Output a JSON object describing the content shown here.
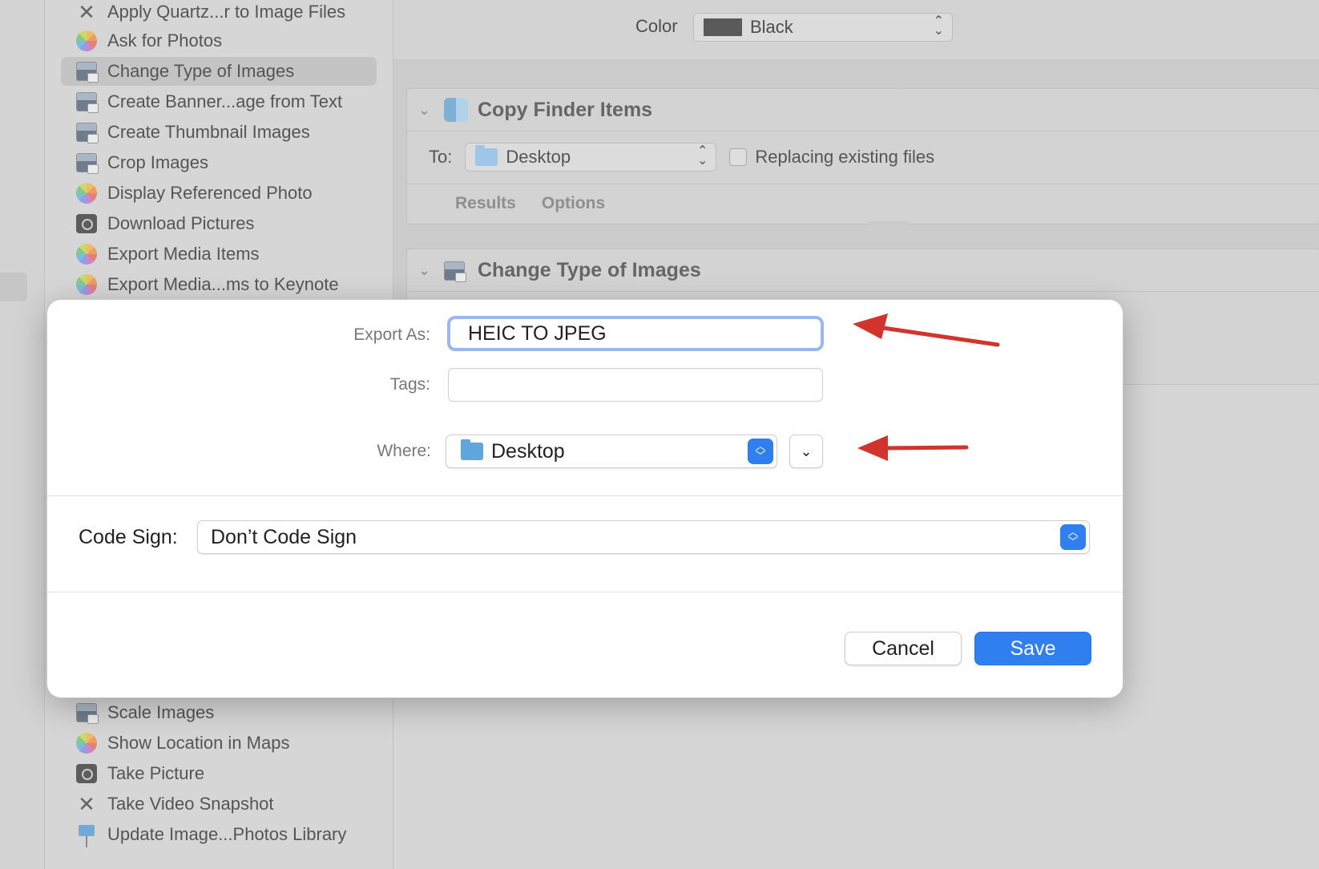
{
  "sidebar": {
    "items": [
      {
        "label": "Apply Quartz...r to Image Files",
        "icon": "tools-icon"
      },
      {
        "label": "Ask for Photos",
        "icon": "photos-icon"
      },
      {
        "label": "Change Type of Images",
        "icon": "image-icon",
        "selected": true
      },
      {
        "label": "Create Banner...age from Text",
        "icon": "image-icon"
      },
      {
        "label": "Create Thumbnail Images",
        "icon": "image-icon"
      },
      {
        "label": "Crop Images",
        "icon": "image-icon"
      },
      {
        "label": "Display Referenced Photo",
        "icon": "photos-icon"
      },
      {
        "label": "Download Pictures",
        "icon": "camera-icon"
      },
      {
        "label": "Export Media Items",
        "icon": "photos-icon"
      },
      {
        "label": "Export Media...ms to Keynote",
        "icon": "photos-icon"
      }
    ],
    "bottom_items": [
      {
        "label": "Scale Images",
        "icon": "image-icon"
      },
      {
        "label": "Show Location in Maps",
        "icon": "photos-icon"
      },
      {
        "label": "Take Picture",
        "icon": "camera-icon"
      },
      {
        "label": "Take Video Snapshot",
        "icon": "tools-icon"
      },
      {
        "label": "Update Image...Photos Library",
        "icon": "keynote-icon"
      }
    ]
  },
  "workflow": {
    "color_label": "Color",
    "color_value": "Black",
    "copy_action": {
      "title": "Copy Finder Items",
      "to_label": "To:",
      "to_value": "Desktop",
      "replace_label": "Replacing existing files",
      "tabs": [
        "Results",
        "Options"
      ]
    },
    "change_action": {
      "title": "Change Type of Images"
    }
  },
  "dialog": {
    "export_as_label": "Export As:",
    "export_as_value": "HEIC TO JPEG",
    "tags_label": "Tags:",
    "tags_value": "",
    "where_label": "Where:",
    "where_value": "Desktop",
    "code_sign_label": "Code Sign:",
    "code_sign_value": "Don’t Code Sign",
    "cancel_label": "Cancel",
    "save_label": "Save"
  },
  "colors": {
    "accent": "#2f7ff0",
    "annotation_arrow": "#d0342c",
    "focus_ring": "#9ab8ee"
  }
}
